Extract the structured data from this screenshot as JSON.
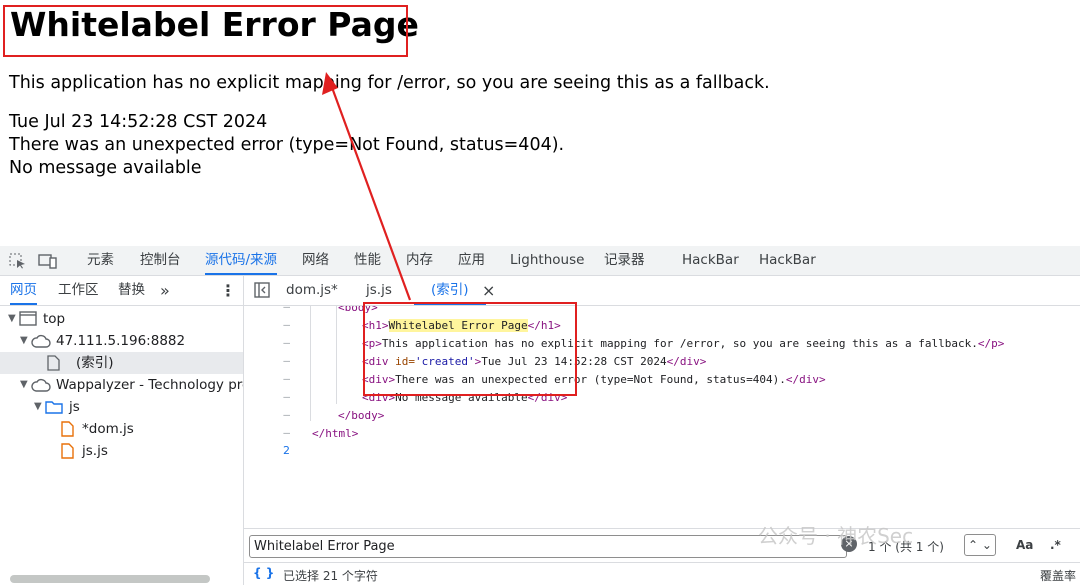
{
  "page": {
    "title": "Whitelabel Error Page",
    "line1": "This application has no explicit mapping for /error, so you are seeing this as a fallback.",
    "timestamp": "Tue Jul 23 14:52:28 CST 2024",
    "error": "There was an unexpected error (type=Not Found, status=404).",
    "message": "No message available"
  },
  "devtools": {
    "tabs": [
      "元素",
      "控制台",
      "源代码/来源",
      "网络",
      "性能",
      "内存",
      "应用",
      "Lighthouse",
      "记录器",
      "HackBar",
      "HackBar"
    ],
    "active_tab": "源代码/来源",
    "sidebar_tabs": [
      "网页",
      "工作区",
      "替换",
      "»"
    ],
    "tree": {
      "top": "top",
      "host": "47.111.5.196:8882",
      "index": "(索引)",
      "ext": "Wappalyzer - Technology prof",
      "folder": "js",
      "file1": "*dom.js",
      "file2": "js.js"
    },
    "editor_tabs": [
      "dom.js*",
      "js.js",
      "(索引)"
    ],
    "close_glyph": "×",
    "code": {
      "dash": "–",
      "last_line_number": "2",
      "body_open": "<body>",
      "h1_open": "<h1>",
      "h1_text": "Whitelabel Error Page",
      "h1_close": "</h1>",
      "p_open": "<p>",
      "p_text": "This application has no explicit mapping for /error, so you are seeing this as a fallback.",
      "p_close": "</p>",
      "div_open_a": "<div ",
      "div_attr": "id=",
      "div_val": "'created'",
      "div_gt": ">",
      "div_text": "Tue Jul 23 14:52:28 CST 2024",
      "div_close": "</div>",
      "div_open": "<div>",
      "div2_text": "There was an unexpected error (type=Not Found, status=404).",
      "div3_text": "No message available",
      "body_close": "</body>",
      "html_close": "</html>"
    },
    "search": {
      "value": "Whitelabel Error Page",
      "result": "1 个 (共 1 个)",
      "match_case": "Aa",
      "regex": ".*"
    },
    "status": {
      "braces": "{ }",
      "selection": "已选择 21 个字符",
      "coverage": "覆盖率"
    }
  },
  "watermark": "公众号 · 神农Sec",
  "colors": {
    "accent": "#1a73e8",
    "annotation_red": "#e02020"
  }
}
